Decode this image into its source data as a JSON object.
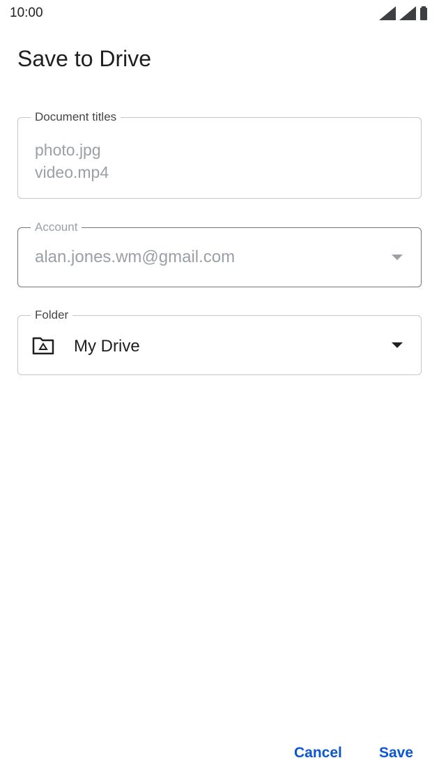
{
  "status_bar": {
    "time": "10:00",
    "icons": [
      "wifi-icon",
      "signal-icon",
      "battery-icon"
    ]
  },
  "page": {
    "title": "Save to Drive"
  },
  "document_titles": {
    "label": "Document titles",
    "lines": [
      "photo.jpg",
      "video.mp4"
    ]
  },
  "account": {
    "label": "Account",
    "value": "alan.jones.wm@gmail.com",
    "icon": "chevron-down-icon"
  },
  "folder": {
    "label": "Folder",
    "value": "My Drive",
    "icon": "drive-folder-icon"
  },
  "actions": {
    "cancel_label": "Cancel",
    "save_label": "Save"
  },
  "colors": {
    "accent": "#0b57d0",
    "disabled_text": "#9aa0a6",
    "border": "#c4c7c5"
  }
}
